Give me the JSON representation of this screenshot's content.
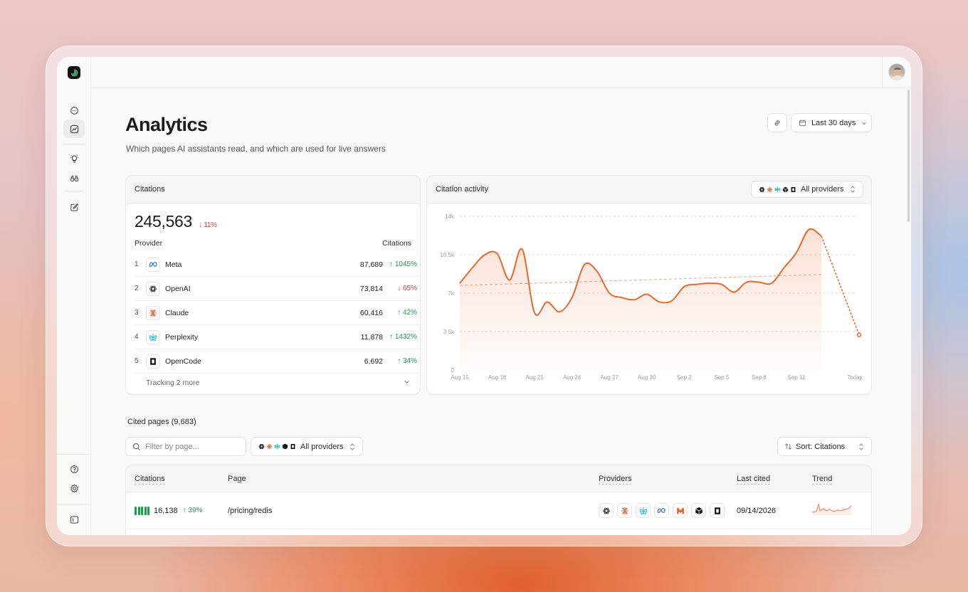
{
  "page": {
    "title": "Analytics",
    "subtitle": "Which pages AI assistants read, and which are used for live answers"
  },
  "toolbar": {
    "date_range_label": "Last 30 days"
  },
  "citations_card": {
    "title": "Citations",
    "total": "245,563",
    "total_delta": "↓ 11%",
    "col_provider": "Provider",
    "col_citations": "Citations",
    "providers": [
      {
        "rank": "1",
        "name": "Meta",
        "value": "87,689",
        "delta": "↑ 1045%",
        "icon": "meta-icon"
      },
      {
        "rank": "2",
        "name": "OpenAI",
        "value": "73,814",
        "delta": "↓ 65%",
        "icon": "openai-icon"
      },
      {
        "rank": "3",
        "name": "Claude",
        "value": "60,416",
        "delta": "↑ 42%",
        "icon": "claude-icon"
      },
      {
        "rank": "4",
        "name": "Perplexity",
        "value": "11,878",
        "delta": "↑ 1432%",
        "icon": "perplexity-icon"
      },
      {
        "rank": "5",
        "name": "OpenCode",
        "value": "6,692",
        "delta": "↑ 34%",
        "icon": "opencode-icon"
      }
    ],
    "more_label": "Tracking 2 more"
  },
  "activity_card": {
    "title": "Citation activity",
    "provider_filter": "All providers"
  },
  "chart_data": {
    "type": "area",
    "title": "Citation activity",
    "xlabel": "",
    "ylabel": "",
    "ylim": [
      0,
      14000
    ],
    "yticks": [
      "0",
      "3.5k",
      "7k",
      "10.5k",
      "14k"
    ],
    "xticks": [
      "Aug 15",
      "Aug 18",
      "Aug 21",
      "Aug 24",
      "Aug 27",
      "Aug 30",
      "Sep 2",
      "Sep 5",
      "Sep 8",
      "Sep 11",
      "Today"
    ],
    "grid": true,
    "color": "#e8692e",
    "series": [
      {
        "x": [
          "Aug 15",
          "Aug 16",
          "Aug 17",
          "Aug 18",
          "Aug 19",
          "Aug 20",
          "Aug 21",
          "Aug 22",
          "Aug 23",
          "Aug 24",
          "Aug 25",
          "Aug 26",
          "Aug 27",
          "Aug 28",
          "Aug 29",
          "Aug 30",
          "Aug 31",
          "Sep 1",
          "Sep 2",
          "Sep 3",
          "Sep 4",
          "Sep 5",
          "Sep 6",
          "Sep 7",
          "Sep 8",
          "Sep 9",
          "Sep 10",
          "Sep 11",
          "Sep 12",
          "Sep 13"
        ],
        "values": [
          7900,
          9300,
          10500,
          10600,
          8200,
          11000,
          5200,
          6200,
          5300,
          6600,
          9600,
          9000,
          7000,
          6600,
          6400,
          6900,
          6200,
          6300,
          7600,
          7800,
          7900,
          7800,
          7100,
          8000,
          8000,
          7900,
          9300,
          10700,
          12800,
          12200
        ]
      }
    ],
    "trend": {
      "start": 7700,
      "end": 8700,
      "style": "dashed"
    },
    "today_value": 3200
  },
  "cited_pages": {
    "title": "Cited pages (9,683)",
    "filter_placeholder": "Filter by page...",
    "provider_filter": "All providers",
    "sort_label": "Sort: Citations",
    "columns": {
      "citations": "Citations",
      "page": "Page",
      "providers": "Providers",
      "last_cited": "Last cited",
      "trend": "Trend"
    },
    "rows": [
      {
        "citations": "16,138",
        "delta": "↑ 39%",
        "page": "/pricing/redis",
        "last_cited": "09/14/2026",
        "bar_level": 5,
        "providers": [
          "openai-icon",
          "claude-icon",
          "perplexity-icon",
          "meta-icon",
          "mistral-icon",
          "cube-icon",
          "opencode-icon"
        ]
      }
    ]
  },
  "colors": {
    "accent": "#e8692e",
    "positive": "#1f9a57",
    "negative": "#dc3b3b"
  }
}
